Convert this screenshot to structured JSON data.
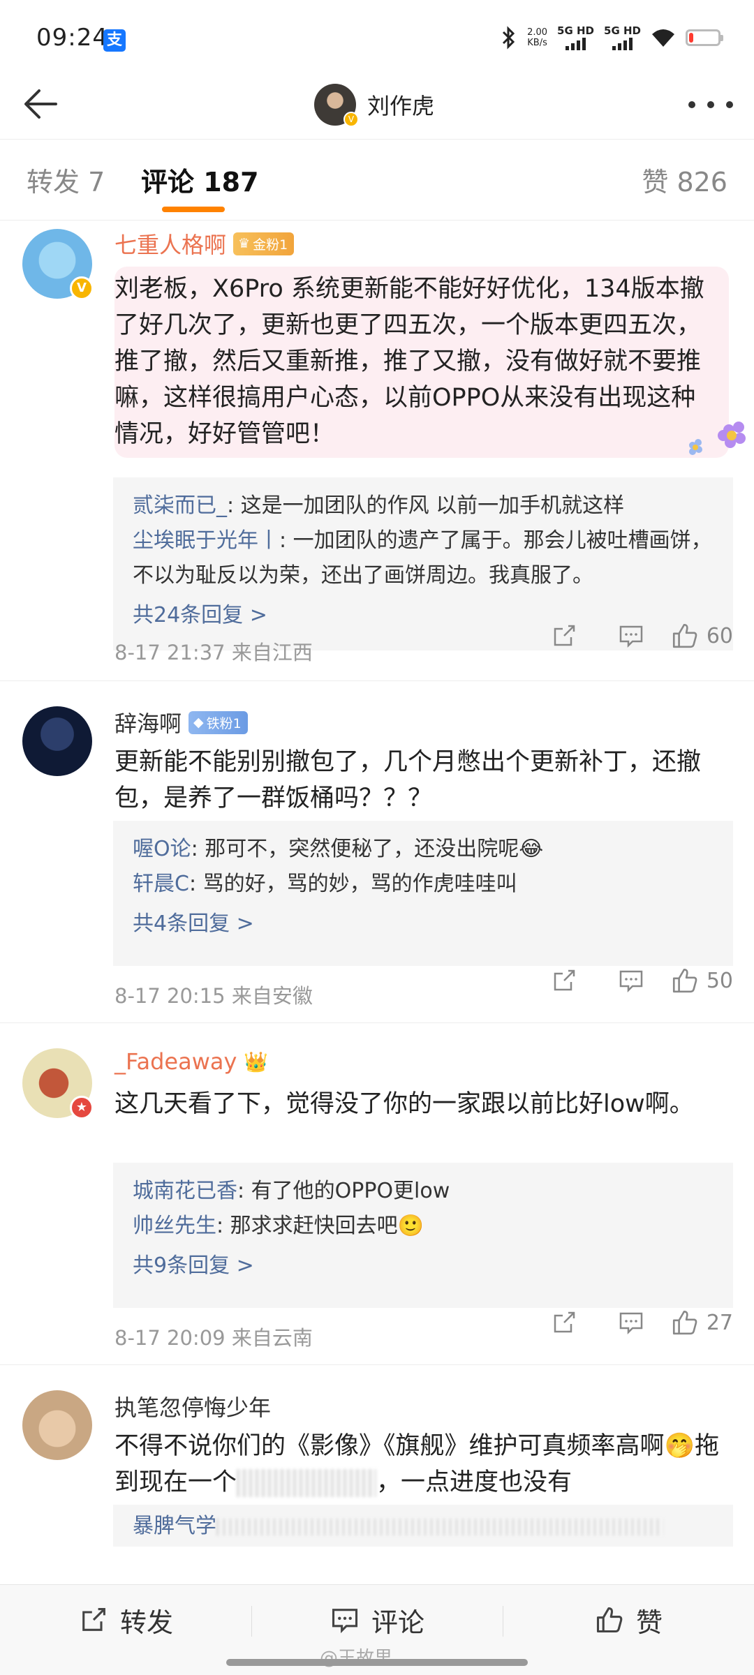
{
  "status_bar": {
    "time": "09:24",
    "speed_value": "2.00",
    "speed_unit": "KB/s",
    "sim1": "5G HD",
    "sim2": "5G HD",
    "battery_level": 0.15,
    "battery_color": "#ff3b30"
  },
  "header": {
    "title": "刘作虎"
  },
  "tabs": {
    "repost": "转发 7",
    "comment": "评论 187",
    "like": "赞 826",
    "active_color": "#ff8200"
  },
  "comments": [
    {
      "user": "七重人格啊",
      "badge": "金粉1",
      "text": "刘老板，X6Pro 系统更新能不能好好优化，134版本撤了好几次了，更新也更了四五次，一个版本更四五次，推了撤，然后又重新推，推了又撤，没有做好就不要推嘛，这样很搞用户心态，以前OPPO从来没有出现这种情况，好好管管吧！",
      "replies": [
        {
          "user": "贰柒而已_",
          "text": ": 这是一加团队的作风 以前一加手机就这样"
        },
        {
          "user": "尘埃眠于光年丨",
          "text": ": 一加团队的遗产了属于。那会儿被吐槽画饼，不以为耻反以为荣，还出了画饼周边。我真服了。"
        }
      ],
      "more": "共24条回复 >",
      "meta": "8-17 21:37  来自江西",
      "likes": "60"
    },
    {
      "user": "辞海啊",
      "badge": "铁粉1",
      "text": "更新能不能别别撤包了，几个月憋出个更新补丁，还撤包，是养了一群饭桶吗？？？",
      "replies": [
        {
          "user": "喔O论",
          "text": ": 那可不，突然便秘了，还没出院呢",
          "emoji": "😂"
        },
        {
          "user": "轩晨C",
          "text": ": 骂的好，骂的妙，骂的作虎哇哇叫"
        }
      ],
      "more": "共4条回复 >",
      "meta": "8-17 20:15  来自安徽",
      "likes": "50"
    },
    {
      "user": "_Fadeaway",
      "crown": "👑",
      "text": "这几天看了下，觉得没了你的一家跟以前比好low啊。",
      "replies": [
        {
          "user": "城南花已香",
          "text": ": 有了他的OPPO更low"
        },
        {
          "user": "帅丝先生",
          "text": ": 那求求赶快回去吧",
          "emoji": "🙂"
        }
      ],
      "more": "共9条回复 >",
      "meta": "8-17 20:09  来自云南",
      "likes": "27"
    },
    {
      "user": "执笔忽停悔少年",
      "text_a": "不得不说你们的《影像》《旗舰》维护可真频率高啊",
      "emoji": "🤭",
      "text_b": "拖到现在一个",
      "text_c": "，一点进度也没有",
      "reply_user": "暴脾气学"
    }
  ],
  "bottom_bar": {
    "repost": "转发",
    "comment": "评论",
    "like": "赞",
    "watermark": "@王故里"
  }
}
